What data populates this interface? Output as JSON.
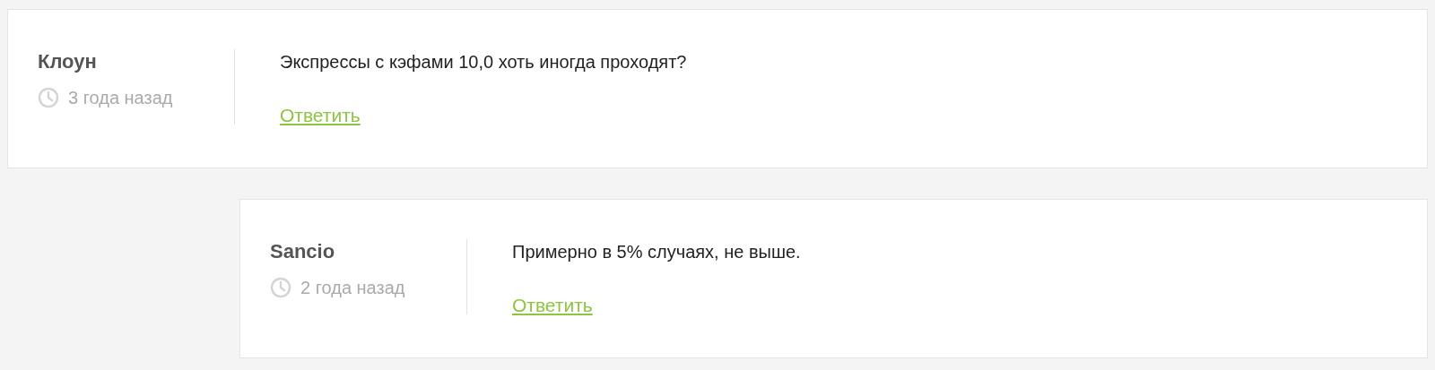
{
  "comments": [
    {
      "author": "Клоун",
      "time": "3 года назад",
      "text": "Экспрессы с кэфами 10,0 хоть иногда проходят?",
      "reply": "Ответить",
      "children": [
        {
          "author": "Sancio",
          "time": "2 года назад",
          "text": "Примерно в 5% случаях, не выше.",
          "reply": "Ответить"
        }
      ]
    }
  ]
}
